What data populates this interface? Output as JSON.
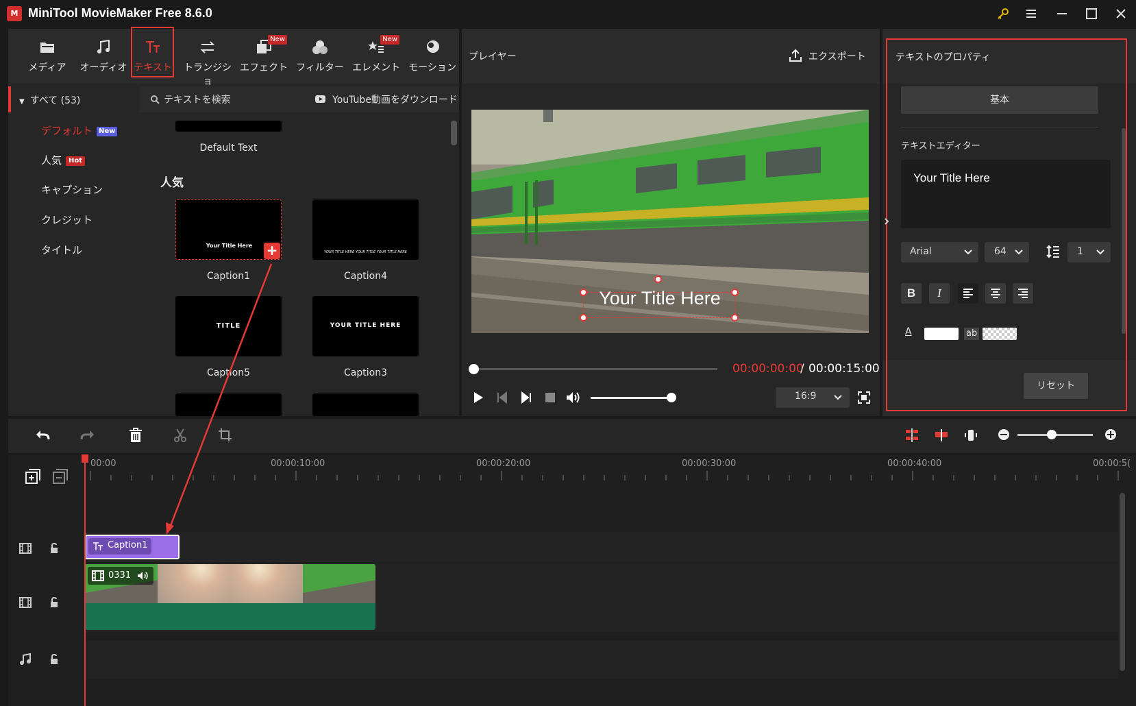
{
  "app": {
    "title": "MiniTool MovieMaker Free 8.6.0",
    "logo": "M"
  },
  "window": {
    "key_icon": "key-icon",
    "menu_icon": "menu-icon"
  },
  "toolbar": {
    "tabs": [
      {
        "label": "メディア",
        "icon": "folder-icon"
      },
      {
        "label": "オーディオ",
        "icon": "music-note-icon"
      },
      {
        "label": "テキスト",
        "icon": "text-icon",
        "active": true
      },
      {
        "label": "トランジショ",
        "icon": "swap-arrows-icon"
      },
      {
        "label": "エフェクト",
        "icon": "effect-icon",
        "badge": "New"
      },
      {
        "label": "フィルター",
        "icon": "filter-icon"
      },
      {
        "label": "エレメント",
        "icon": "element-icon",
        "badge": "New"
      },
      {
        "label": "モーション",
        "icon": "motion-icon"
      }
    ]
  },
  "categories": {
    "header": "すべて (53)",
    "items": [
      {
        "label": "デフォルト",
        "badge": "New",
        "active": true
      },
      {
        "label": "人気",
        "badge": "Hot"
      },
      {
        "label": "キャプション"
      },
      {
        "label": "クレジット"
      },
      {
        "label": "タイトル"
      }
    ]
  },
  "search": {
    "placeholder": "テキストを検索",
    "download_label": "YouTube動画をダウンロード"
  },
  "library": {
    "default_label": "Default Text",
    "section_title": "人気",
    "items": [
      {
        "label": "Caption1",
        "preview_text": "Your   Title Here"
      },
      {
        "label": "Caption4",
        "preview_text": "YOUR TITLE HERE YOUR TITLE YOUR TITLE HERE"
      },
      {
        "label": "Caption5",
        "preview_text": "TITLE"
      },
      {
        "label": "Caption3",
        "preview_text": "YOUR TITLE HERE"
      }
    ]
  },
  "player": {
    "title": "プレイヤー",
    "export_label": "エクスポート",
    "overlay_text": "Your Title Here",
    "current_time": "00:00:00:00",
    "separator": "/",
    "total_time": "00:00:15:00",
    "aspect_ratio": "16:9",
    "progress": 0,
    "volume": 1.0
  },
  "properties": {
    "title": "テキストのプロパティ",
    "tab_basic": "基本",
    "editor_label": "テキストエディター",
    "editor_text": "Your Title Here",
    "font": "Arial",
    "size": "64",
    "line_spacing": "1",
    "bold": "B",
    "italic": "I",
    "text_color_label": "A",
    "bg_label": "ab",
    "reset_label": "リセット"
  },
  "timeline": {
    "ruler": [
      "00:00",
      "00:00:10:00",
      "00:00:20:00",
      "00:00:30:00",
      "00:00:40:00",
      "00:00:5("
    ],
    "text_clip_label": "Caption1",
    "video_clip_label": "0331",
    "zoom": 0.45
  },
  "colors": {
    "accent_red": "#e53935",
    "text_clip": "#9b6ee8",
    "video_track": "#187150"
  }
}
